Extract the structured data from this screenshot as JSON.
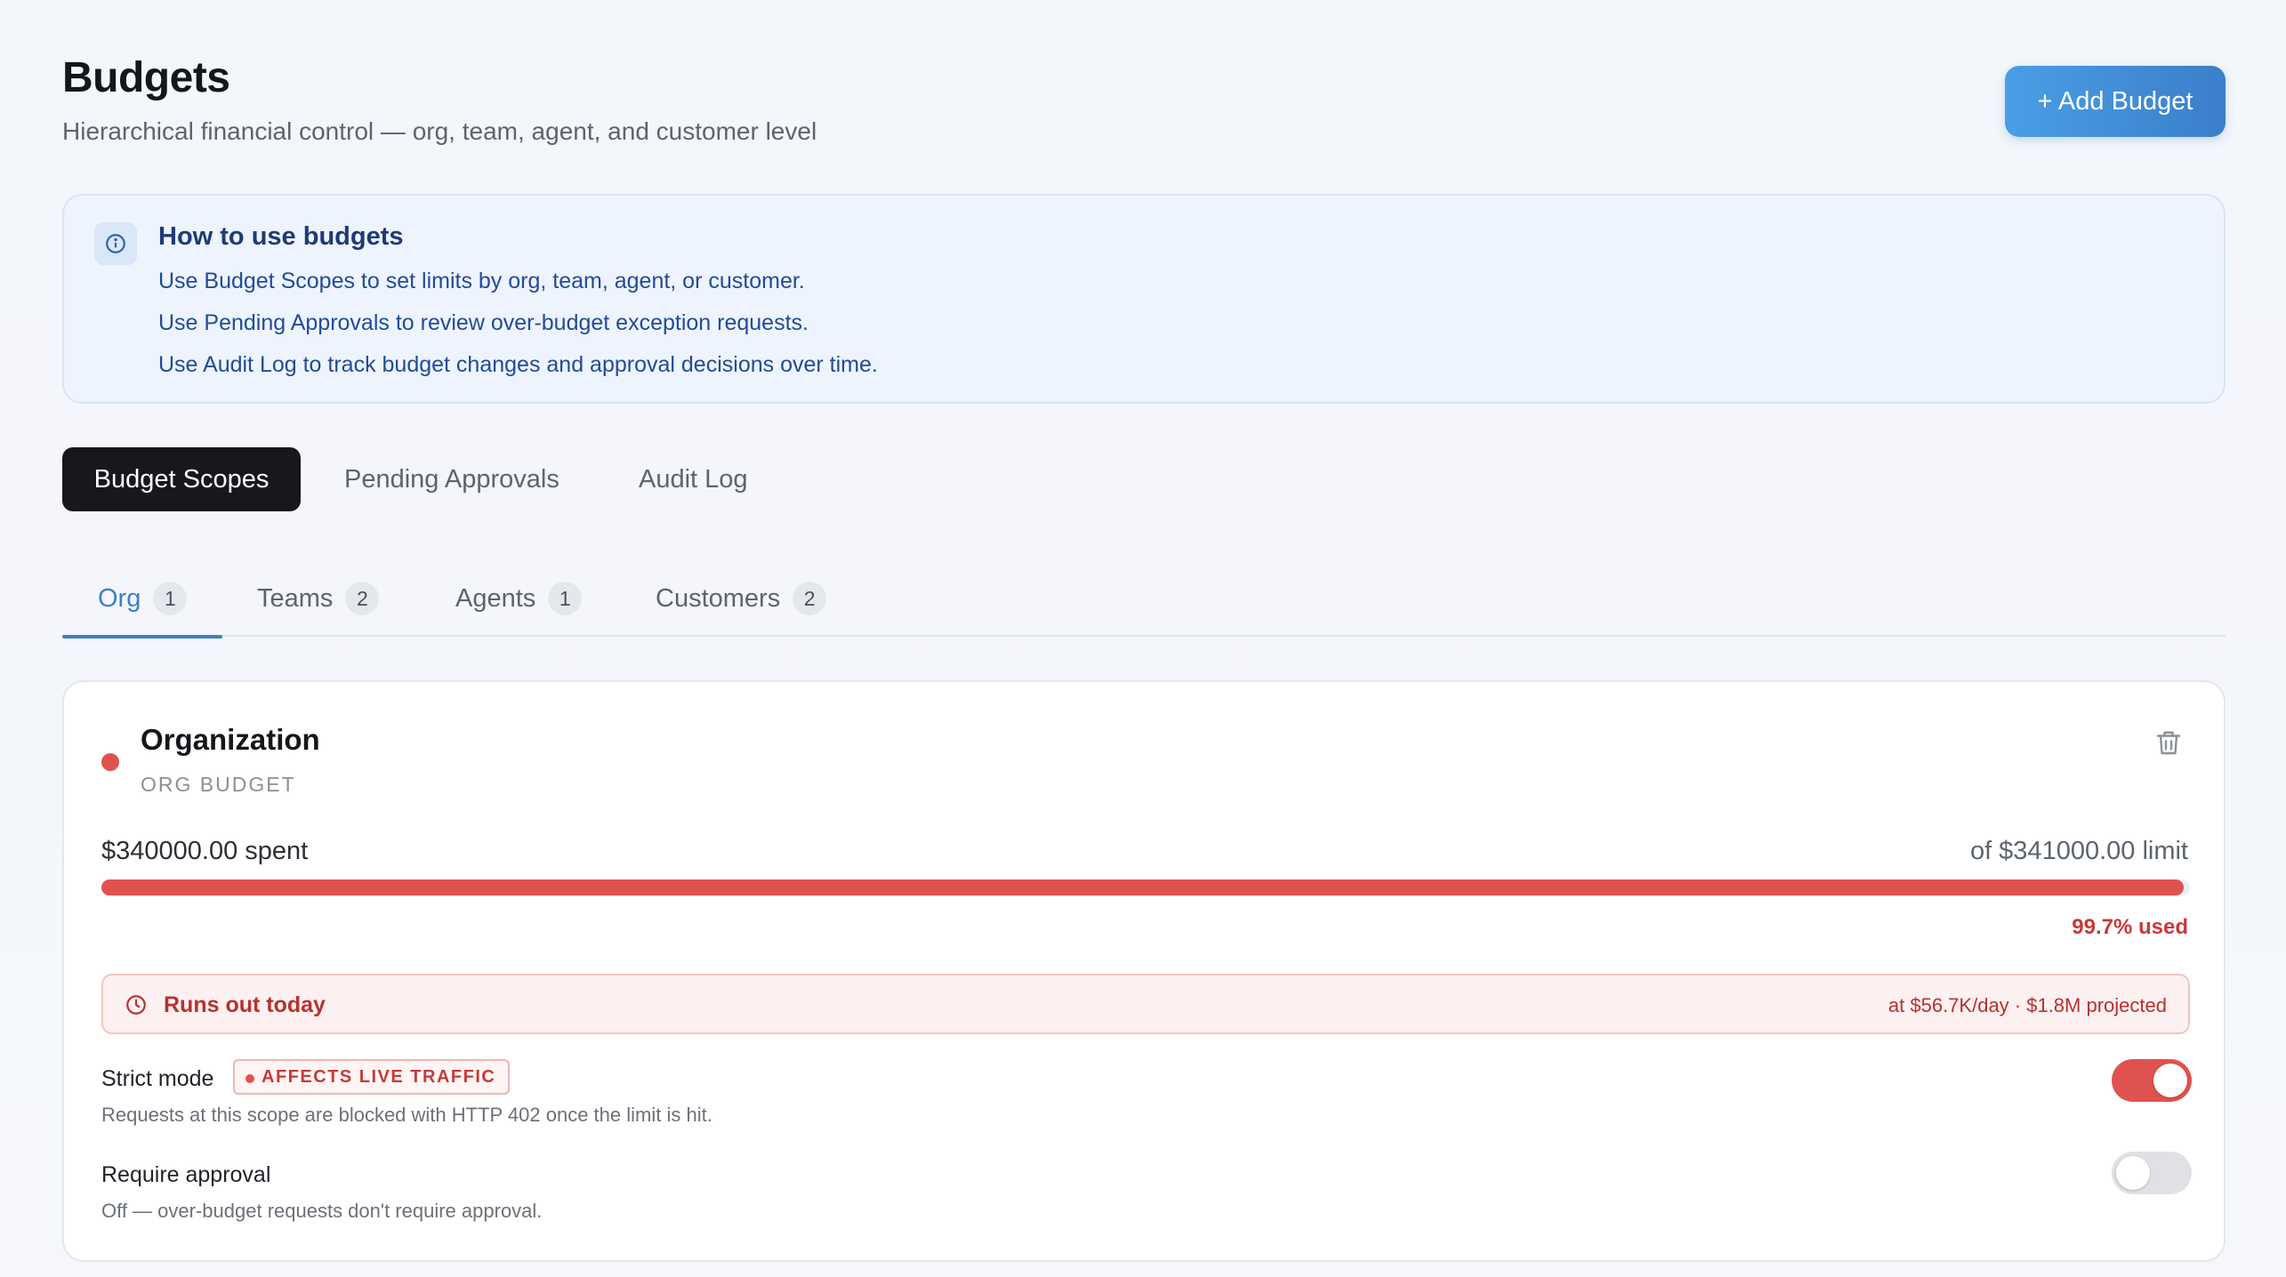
{
  "header": {
    "title": "Budgets",
    "subtitle": "Hierarchical financial control — org, team, agent, and customer level",
    "add_button_label": "+ Add Budget"
  },
  "info": {
    "title": "How to use budgets",
    "lines": [
      "Use Budget Scopes to set limits by org, team, agent, or customer.",
      "Use Pending Approvals to review over-budget exception requests.",
      "Use Audit Log to track budget changes and approval decisions over time."
    ],
    "icon": "info-icon"
  },
  "tabs": [
    {
      "label": "Budget Scopes",
      "active": true
    },
    {
      "label": "Pending Approvals",
      "active": false
    },
    {
      "label": "Audit Log",
      "active": false
    }
  ],
  "subtabs": [
    {
      "label": "Org",
      "count": "1",
      "active": true
    },
    {
      "label": "Teams",
      "count": "2",
      "active": false
    },
    {
      "label": "Agents",
      "count": "1",
      "active": false
    },
    {
      "label": "Customers",
      "count": "2",
      "active": false
    }
  ],
  "card": {
    "title": "Organization",
    "type_label": "ORG BUDGET",
    "status_color": "#e0524f",
    "spent_text": "$340000.00 spent",
    "limit_text": "of $341000.00 limit",
    "used_text": "99.7% used",
    "used_fraction": 0.997,
    "alert": {
      "title": "Runs out today",
      "meta": "at $56.7K/day · $1.8M projected",
      "icon": "clock-icon"
    },
    "strict_mode": {
      "label": "Strict mode",
      "badge": "AFFECTS LIVE TRAFFIC",
      "description": "Requests at this scope are blocked with HTTP 402 once the limit is hit.",
      "enabled": true
    },
    "require_approval": {
      "label": "Require approval",
      "description": "Off — over-budget requests don't require approval.",
      "enabled": false
    }
  },
  "colors": {
    "accent": "#3a7fc9",
    "danger": "#e0524f",
    "tab_active_bg": "#16181b"
  }
}
